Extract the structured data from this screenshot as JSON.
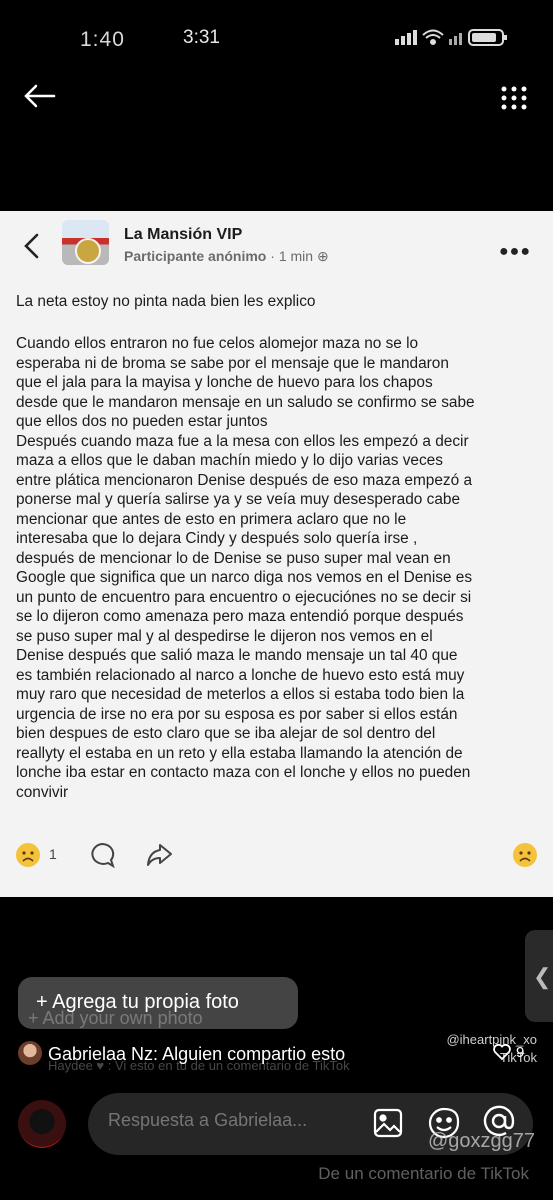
{
  "status_bar": {
    "time_overlay": "1:40",
    "time": "3:31"
  },
  "header": {
    "back_icon": "back-arrow-icon",
    "more_icon": "more-vertical-icon"
  },
  "post": {
    "group_name": "La Mansión VIP",
    "author": "Participante anónimo",
    "time": "1 min",
    "title": "La neta estoy no pinta nada bien les explico",
    "body_lines": [
      "Cuando ellos entraron no fue celos alomejor maza no se lo",
      "esperaba ni de broma se sabe por el mensaje que le mandaron",
      "que el jala para la mayisa y lonche de huevo para los chapos",
      "desde que le mandaron mensaje en un saludo se confirmo se sabe",
      "que ellos dos no pueden estar juntos",
      "Después cuando maza fue a la mesa con ellos les empezó a decir",
      "maza a ellos que le daban machín miedo y lo dijo varias veces",
      "entre plática mencionaron Denise después de eso maza empezó a",
      "ponerse mal y quería salirse ya y se veía muy desesperado cabe",
      "mencionar que antes de esto en primera aclaro que no le",
      "interesaba que lo dejara Cindy y después solo quería irse ,",
      "después de mencionar lo de Denise se puso super mal vean en",
      "Google que significa que un narco diga nos vemos en el Denise es",
      "un punto de encuentro para encuentro o ejecuciónes no se decir si",
      "se lo dijeron como amenaza pero maza entendió porque después",
      "se puso super mal y al despedirse le dijeron nos vemos en el",
      "Denise después que salió maza le mando mensaje un tal 40 que",
      "es también relacionado al narco a lonche de huevo esto está muy",
      "muy raro que necesidad de meterlos a ellos si estaba todo bien la",
      "urgencia de irse no era por su esposa es por saber si ellos están",
      "bien despues de esto claro que se iba alejar de sol dentro del",
      "reallyty el estaba en un reto y ella estaba llamando la atención de",
      "lonche iba estar en contacto maza con el lonche y ellos no pueden",
      "convivir"
    ],
    "reaction_count": "1"
  },
  "overlay": {
    "add_photo": "+ Agrega tu propia foto",
    "add_photo_ghost": "+ Add your own photo",
    "watermark_handle": "@iheartpink_xo",
    "watermark_tiktok": "TikTok",
    "comment_user": "Gabrielaa Nz:",
    "comment_text": "Alguien compartio esto",
    "comment_ghost": "Haydee ♥ : Vi esto en tu de un comentario de TikTok",
    "likes": "9"
  },
  "reply": {
    "placeholder": "Respuesta a Gabrielaa...",
    "watermark_user": "@goxzgg77",
    "watermark_bottom": "De un comentario de TikTok"
  }
}
